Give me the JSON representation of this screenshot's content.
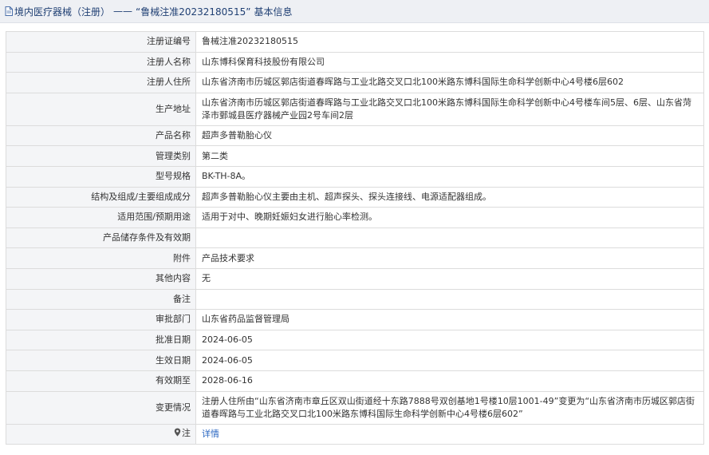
{
  "header": {
    "prefix": "境内医疗器械（注册）",
    "separator": "——",
    "title": "“鲁械注准20232180515”",
    "suffix": "基本信息"
  },
  "rows": [
    {
      "label": "注册证编号",
      "value": "鲁械注准20232180515"
    },
    {
      "label": "注册人名称",
      "value": "山东博科保育科技股份有限公司"
    },
    {
      "label": "注册人住所",
      "value": "山东省济南市历城区郭店街道春晖路与工业北路交叉口北100米路东博科国际生命科学创新中心4号楼6层602"
    },
    {
      "label": "生产地址",
      "value": "山东省济南市历城区郭店街道春晖路与工业北路交叉口北100米路东博科国际生命科学创新中心4号楼车间5层、6层、山东省菏泽市鄄城县医疗器械产业园2号车间2层"
    },
    {
      "label": "产品名称",
      "value": "超声多普勒胎心仪"
    },
    {
      "label": "管理类别",
      "value": "第二类"
    },
    {
      "label": "型号规格",
      "value": "BK-TH-8A。"
    },
    {
      "label": "结构及组成/主要组成成分",
      "value": "超声多普勒胎心仪主要由主机、超声探头、探头连接线、电源适配器组成。"
    },
    {
      "label": "适用范围/预期用途",
      "value": "适用于对中、晚期妊娠妇女进行胎心率检测。"
    },
    {
      "label": "产品储存条件及有效期",
      "value": ""
    },
    {
      "label": "附件",
      "value": "产品技术要求"
    },
    {
      "label": "其他内容",
      "value": "无"
    },
    {
      "label": "备注",
      "value": ""
    },
    {
      "label": "审批部门",
      "value": "山东省药品监督管理局"
    },
    {
      "label": "批准日期",
      "value": "2024-06-05"
    },
    {
      "label": "生效日期",
      "value": "2024-06-05"
    },
    {
      "label": "有效期至",
      "value": "2028-06-16"
    },
    {
      "label": "变更情况",
      "value": "注册人住所由“山东省济南市章丘区双山街道经十东路7888号双创基地1号楼10层1001-49”变更为“山东省济南市历城区郭店街道春晖路与工业北路交叉口北100米路东博科国际生命科学创新中心4号楼6层602”"
    }
  ],
  "note": {
    "label": "注",
    "link": "详情"
  },
  "colors": {
    "header_bg": "#eef0f4",
    "header_text": "#1f3f73",
    "label_bg": "#f4f5f7",
    "border": "#dcdcdc",
    "link": "#2a67c2"
  }
}
